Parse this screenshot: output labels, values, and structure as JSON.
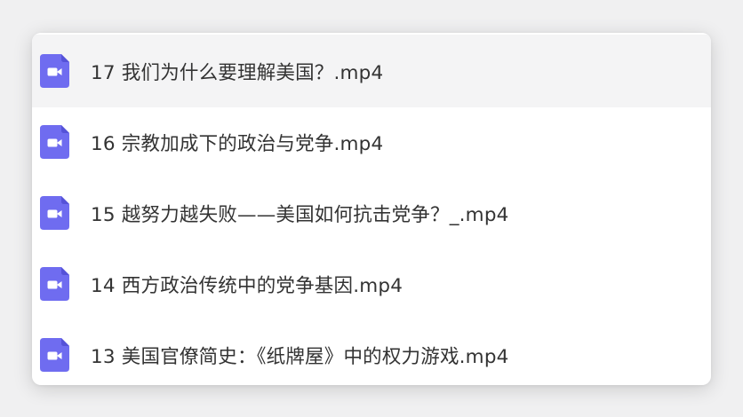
{
  "colors": {
    "icon_bg": "#6f6cf0",
    "icon_glyph": "#ffffff",
    "text": "#333333",
    "hover_row": "#f4f4f5"
  },
  "file_list": {
    "items": [
      {
        "name": "17 我们为什么要理解美国？.mp4",
        "icon": "video-file-icon",
        "hovered": true
      },
      {
        "name": "16 宗教加成下的政治与党争.mp4",
        "icon": "video-file-icon",
        "hovered": false
      },
      {
        "name": "15 越努力越失败——美国如何抗击党争？_.mp4",
        "icon": "video-file-icon",
        "hovered": false
      },
      {
        "name": "14 西方政治传统中的党争基因.mp4",
        "icon": "video-file-icon",
        "hovered": false
      },
      {
        "name": "13 美国官僚简史：《纸牌屋》中的权力游戏.mp4",
        "icon": "video-file-icon",
        "hovered": false
      }
    ]
  }
}
